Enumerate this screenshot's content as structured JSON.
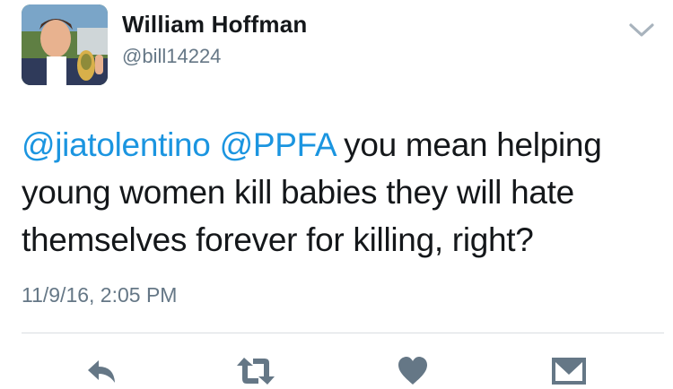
{
  "user": {
    "display_name": "William Hoffman",
    "username": "@bill14224"
  },
  "tweet": {
    "mention_1": "@jiatolentino",
    "mention_2": "@PPFA",
    "body": " you mean helping young women kill babies they will hate themselves forever for killing, right?",
    "timestamp": "11/9/16, 2:05 PM"
  },
  "icons": {
    "caret": "chevron-down-icon",
    "reply": "reply-icon",
    "retweet": "retweet-icon",
    "like": "heart-icon",
    "dm": "envelope-icon"
  },
  "colors": {
    "link": "#1b95e0",
    "text": "#14171a",
    "secondary": "#657786",
    "icon": "#657786",
    "divider": "#dadde1"
  }
}
